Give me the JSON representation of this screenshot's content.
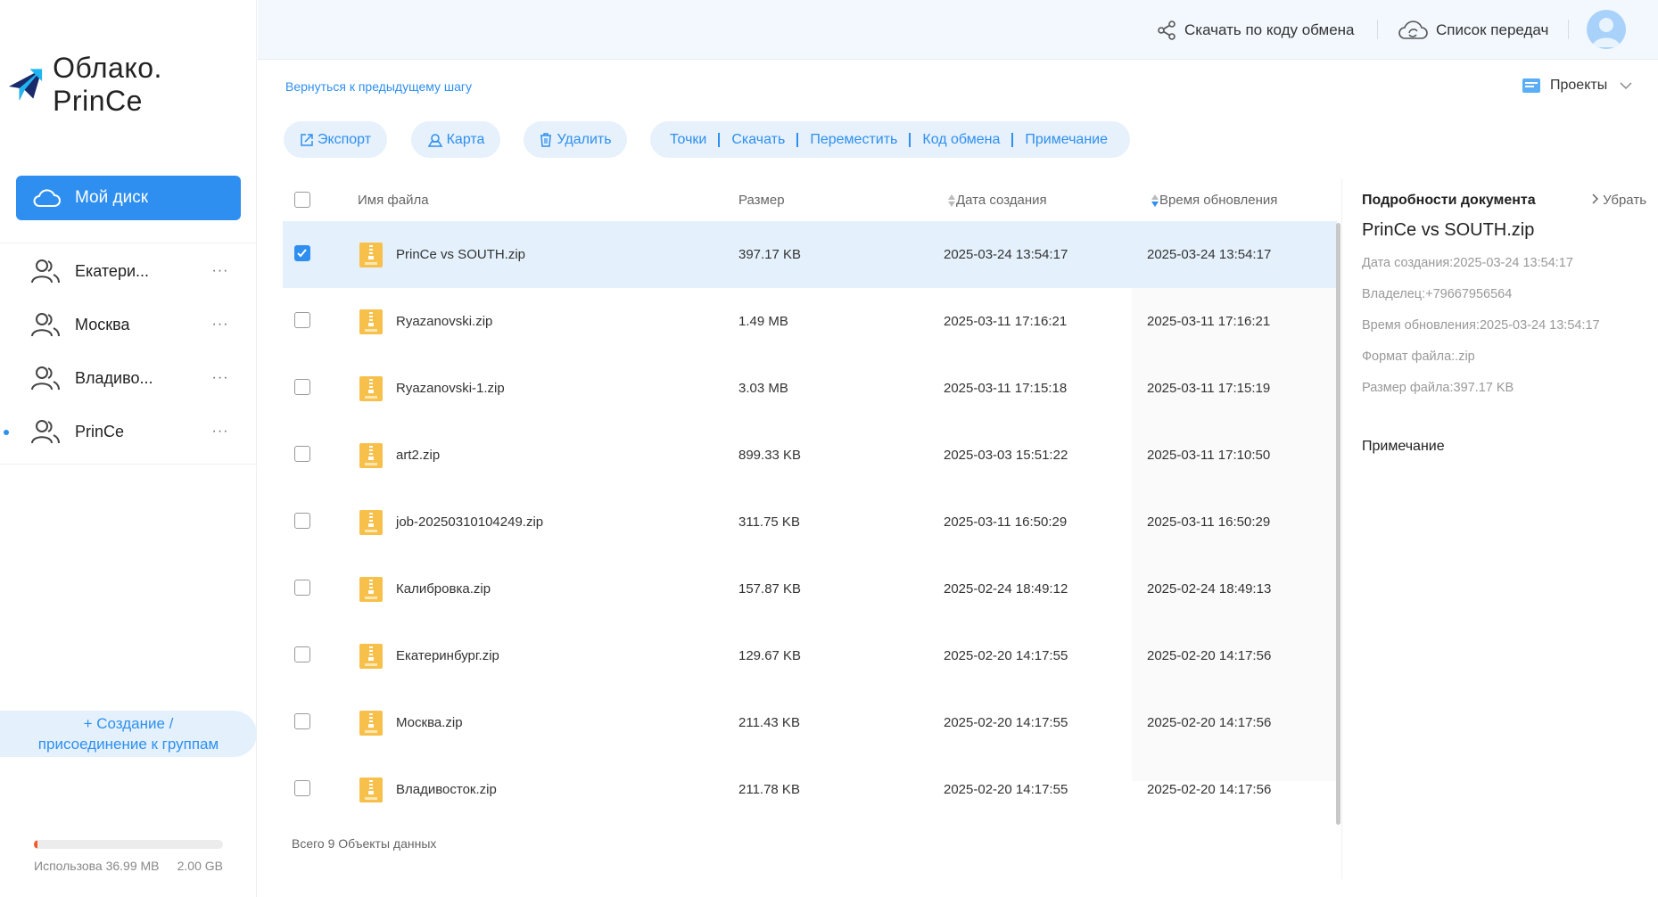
{
  "app": {
    "title": "Облако. PrinCe"
  },
  "sidebar": {
    "my_disk": "Мой диск",
    "groups": [
      {
        "label": "Екатери...",
        "menu": "···"
      },
      {
        "label": "Москва",
        "menu": "···"
      },
      {
        "label": "Владиво...",
        "menu": "···"
      },
      {
        "label": "PrinCe",
        "menu": "···"
      }
    ],
    "create_group_line1": "+ Создание /",
    "create_group_line2": "присоединение к группам",
    "storage": {
      "used": "Использова 36.99 MB",
      "total": "2.00 GB",
      "fraction": 0.018
    }
  },
  "header": {
    "download_by_code": "Скачать по коду обмена",
    "transfers": "Список передач"
  },
  "breadcrumb": {
    "back": "Вернуться к предыдущему шагу"
  },
  "projects": {
    "label": "Проекты"
  },
  "toolbar": {
    "export": "Экспорт",
    "map": "Карта",
    "delete": "Удалить",
    "points": "Точки",
    "download": "Скачать",
    "move": "Переместить",
    "share_code": "Код обмена",
    "note": "Примечание"
  },
  "table": {
    "columns": {
      "name": "Имя файла",
      "size": "Размер",
      "created": "Дата создания",
      "updated": "Время обновления"
    },
    "rows": [
      {
        "name": "PrinCe vs SOUTH.zip",
        "size": "397.17 KB",
        "created": "2025-03-24 13:54:17",
        "updated": "2025-03-24 13:54:17",
        "checked": true
      },
      {
        "name": "Ryazanovski.zip",
        "size": "1.49 MB",
        "created": "2025-03-11 17:16:21",
        "updated": "2025-03-11 17:16:21",
        "checked": false
      },
      {
        "name": "Ryazanovski-1.zip",
        "size": "3.03 MB",
        "created": "2025-03-11 17:15:18",
        "updated": "2025-03-11 17:15:19",
        "checked": false
      },
      {
        "name": "art2.zip",
        "size": "899.33 KB",
        "created": "2025-03-03 15:51:22",
        "updated": "2025-03-11 17:10:50",
        "checked": false
      },
      {
        "name": "job-20250310104249.zip",
        "size": "311.75 KB",
        "created": "2025-03-11 16:50:29",
        "updated": "2025-03-11 16:50:29",
        "checked": false
      },
      {
        "name": "Калибровка.zip",
        "size": "157.87 KB",
        "created": "2025-02-24 18:49:12",
        "updated": "2025-02-24 18:49:13",
        "checked": false
      },
      {
        "name": "Екатеринбург.zip",
        "size": "129.67 KB",
        "created": "2025-02-20 14:17:55",
        "updated": "2025-02-20 14:17:56",
        "checked": false
      },
      {
        "name": "Москва.zip",
        "size": "211.43 KB",
        "created": "2025-02-20 14:17:55",
        "updated": "2025-02-20 14:17:56",
        "checked": false
      },
      {
        "name": "Владивосток.zip",
        "size": "211.78 KB",
        "created": "2025-02-20 14:17:55",
        "updated": "2025-02-20 14:17:56",
        "checked": false
      }
    ],
    "total": "Всего 9 Объекты данных"
  },
  "detail": {
    "title": "Подробности документа",
    "hide": "Убрать",
    "name": "PrinCe vs SOUTH.zip",
    "created": "Дата создания:2025-03-24 13:54:17",
    "owner": "Владелец:+79667956564",
    "updated": "Время обновления:2025-03-24 13:54:17",
    "format": "Формат файла:.zip",
    "size": "Размер файла:397.17 KB",
    "note_label": "Примечание"
  },
  "colors": {
    "accent": "#2e8ff0",
    "accent_light": "#e4f1fc",
    "file_icon": "#f7c04a"
  }
}
